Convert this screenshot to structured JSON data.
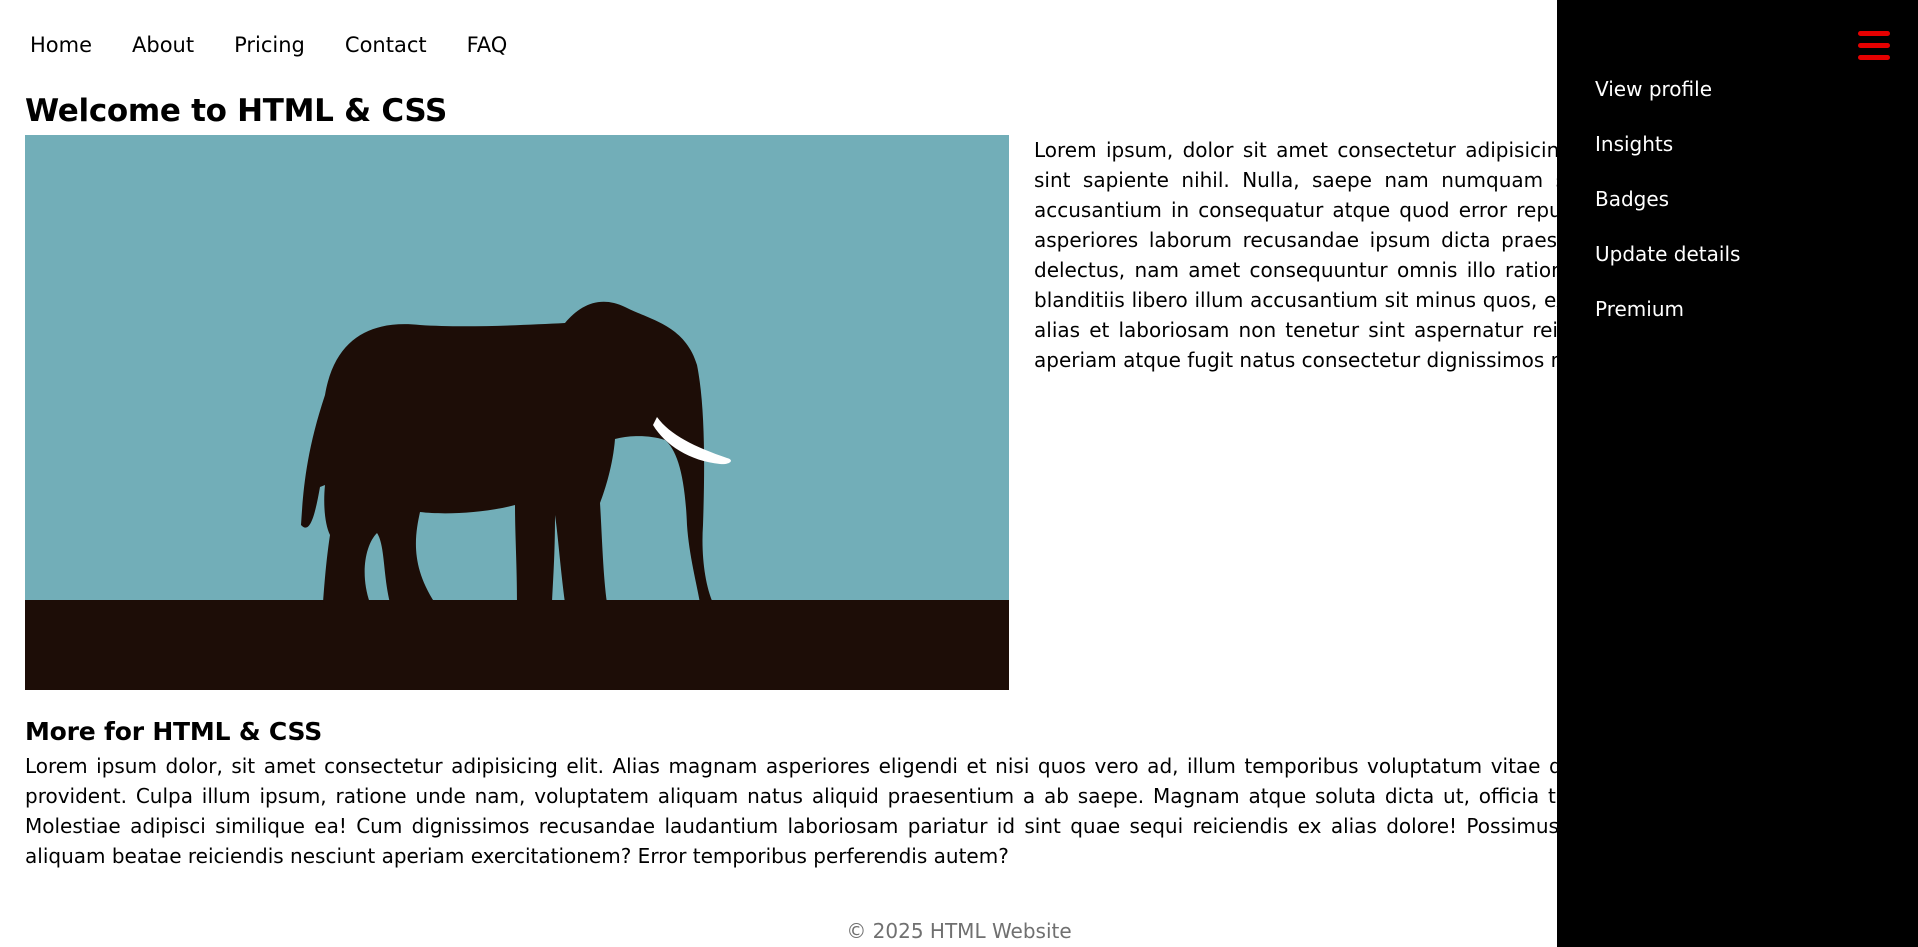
{
  "nav": {
    "items": [
      {
        "label": "Home"
      },
      {
        "label": "About"
      },
      {
        "label": "Pricing"
      },
      {
        "label": "Contact"
      },
      {
        "label": "FAQ"
      }
    ]
  },
  "main": {
    "title": "Welcome to HTML & CSS",
    "intro_text": "Lorem ipsum, dolor sit amet consectetur adipisicing elit. Quas eveniet ratione rerum sint sapiente nihil. Nulla, saepe nam numquam sequi reprehenderit, mollitia modi accusantium in consequatur atque quod error repudiandae ad possimus animi soluta asperiores laborum recusandae ipsum dicta praesentium corrupti sed, placeat modi delectus, nam amet consequuntur omnis illo ratione aperiam. Praesentium voluptate blanditiis libero illum accusantium sit minus quos, expedita. Perferendis cupiditate quia alias et laboriosam non tenetur sint aspernatur reiciendis architecto repellendus ipsa aperiam atque fugit natus consectetur dignissimos molestias."
  },
  "more": {
    "title": "More for HTML & CSS",
    "text": "Lorem ipsum dolor, sit amet consectetur adipisicing elit. Alias magnam asperiores eligendi et nisi quos vero ad, illum temporibus voluptatum vitae distinctio amet voluptatibus porro provident. Culpa illum ipsum, ratione unde nam, voluptatem aliquam natus aliquid praesentium a ab saepe. Magnam atque soluta dicta ut, officia tempora quas sed necessitatibus! Molestiae adipisci similique ea! Cum dignissimos recusandae laudantium laboriosam pariatur id sint quae sequi reiciendis ex alias dolore! Possimus hic natus, molestias quibusdam aliquam beatae reiciendis nesciunt aperiam exercitationem? Error temporibus perferendis autem?"
  },
  "footer": {
    "text": "© 2025 HTML Website"
  },
  "side_menu": {
    "items": [
      {
        "label": "View profile"
      },
      {
        "label": "Insights"
      },
      {
        "label": "Badges"
      },
      {
        "label": "Update details"
      },
      {
        "label": "Premium"
      }
    ],
    "menu_icon": "hamburger-icon"
  },
  "colors": {
    "accent": "#e60000",
    "sidebar_bg": "#000000",
    "sky": "#72aeb8",
    "ground": "#1d0d07"
  }
}
